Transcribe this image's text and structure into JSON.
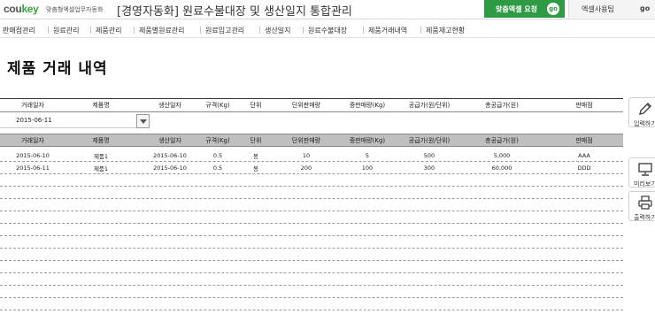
{
  "header": {
    "logo_main": "cou",
    "logo_accent": "key",
    "logo_sub": "맞춤형엑셀업무자동화",
    "title": "[경영자동화] 원료수불대장 및 생산일지 통합관리",
    "request_button": "맞춤엑셀 요청",
    "request_go": "go",
    "tip_button": "엑셀사용팁",
    "tip_go": "go"
  },
  "nav": {
    "items": [
      "판매점관리",
      "원료관리",
      "제품관리",
      "제품별원료관리",
      "원료입고관리",
      "생산일지",
      "원료수불대장",
      "제품거래내역",
      "제품재고현황"
    ]
  },
  "page_title": "제품 거래 내역",
  "columns": [
    "거래일자",
    "제품명",
    "생산일자",
    "규격(Kg)",
    "단위",
    "단위판매량",
    "중판매량(Kg)",
    "공급가(원/단위)",
    "총공급가(원)",
    "판매점"
  ],
  "filter": {
    "date": "2015-06-11"
  },
  "rows": [
    [
      "2015-06-10",
      "제품1",
      "2015-06-10",
      "0.5",
      "봉",
      "10",
      "5",
      "500",
      "5,000",
      "AAA"
    ],
    [
      "2015-06-11",
      "제품1",
      "2015-06-10",
      "0.5",
      "봉",
      "200",
      "100",
      "300",
      "60,000",
      "DDD"
    ]
  ],
  "tools": {
    "input": "입력하기",
    "preview": "미리보기",
    "print": "출력하기"
  }
}
